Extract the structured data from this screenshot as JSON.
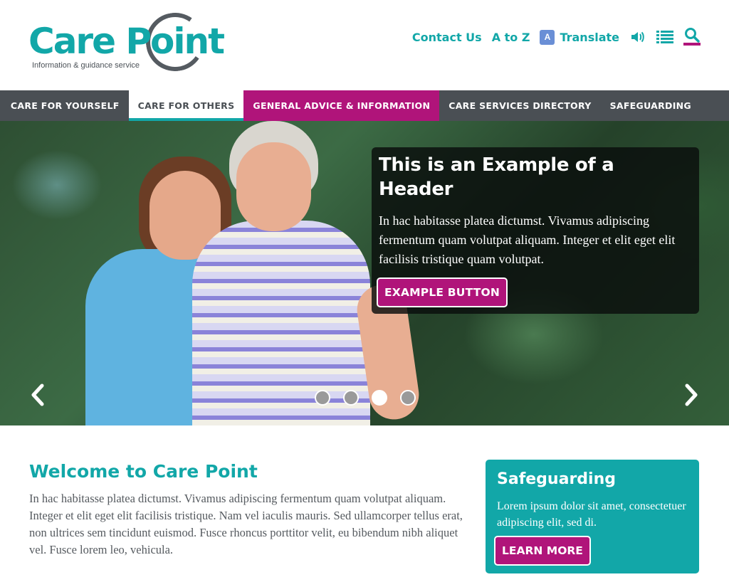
{
  "brand": {
    "name": "Care Point",
    "tagline": "Information & guidance service",
    "teal": "#12a7a8",
    "magenta": "#b0147a",
    "dark": "#4a4f54"
  },
  "top_links": {
    "contact": "Contact Us",
    "a_to_z": "A to Z",
    "translate": "Translate",
    "translate_icon": "translate-icon",
    "audio_icon": "speaker-icon",
    "list_icon": "list-icon",
    "search_icon": "search-icon"
  },
  "nav": {
    "items": [
      {
        "label": "CARE FOR YOURSELF"
      },
      {
        "label": "CARE FOR OTHERS"
      },
      {
        "label": "GENERAL ADVICE & INFORMATION"
      },
      {
        "label": "CARE SERVICES DIRECTORY"
      },
      {
        "label": "SAFEGUARDING"
      }
    ],
    "active_index": 1,
    "highlight_index": 2
  },
  "hero": {
    "title": "This is an Example of a Header",
    "text": "In hac habitasse platea dictumst. Vivamus adipiscing fermentum quam volutpat aliquam. Integer et elit eget elit facilisis tristique quam volutpat.",
    "button": "EXAMPLE BUTTON",
    "slide_count": 4,
    "active_slide": 3,
    "prev_icon": "chevron-left-icon",
    "next_icon": "chevron-right-icon"
  },
  "welcome": {
    "title": "Welcome to Care Point",
    "text": "In hac habitasse platea dictumst. Vivamus adipiscing fermentum quam volutpat aliquam. Integer et elit eget elit facilisis tristique. Nam vel iaculis mauris. Sed ullamcorper tellus erat, non ultrices sem tincidunt euismod. Fusce rhoncus porttitor velit, eu bibendum nibh aliquet vel. Fusce lorem leo, vehicula."
  },
  "safeguarding": {
    "title": "Safeguarding",
    "text": "Lorem ipsum dolor sit amet, consectetuer adipiscing elit, sed di.",
    "button": "LEARN MORE"
  }
}
